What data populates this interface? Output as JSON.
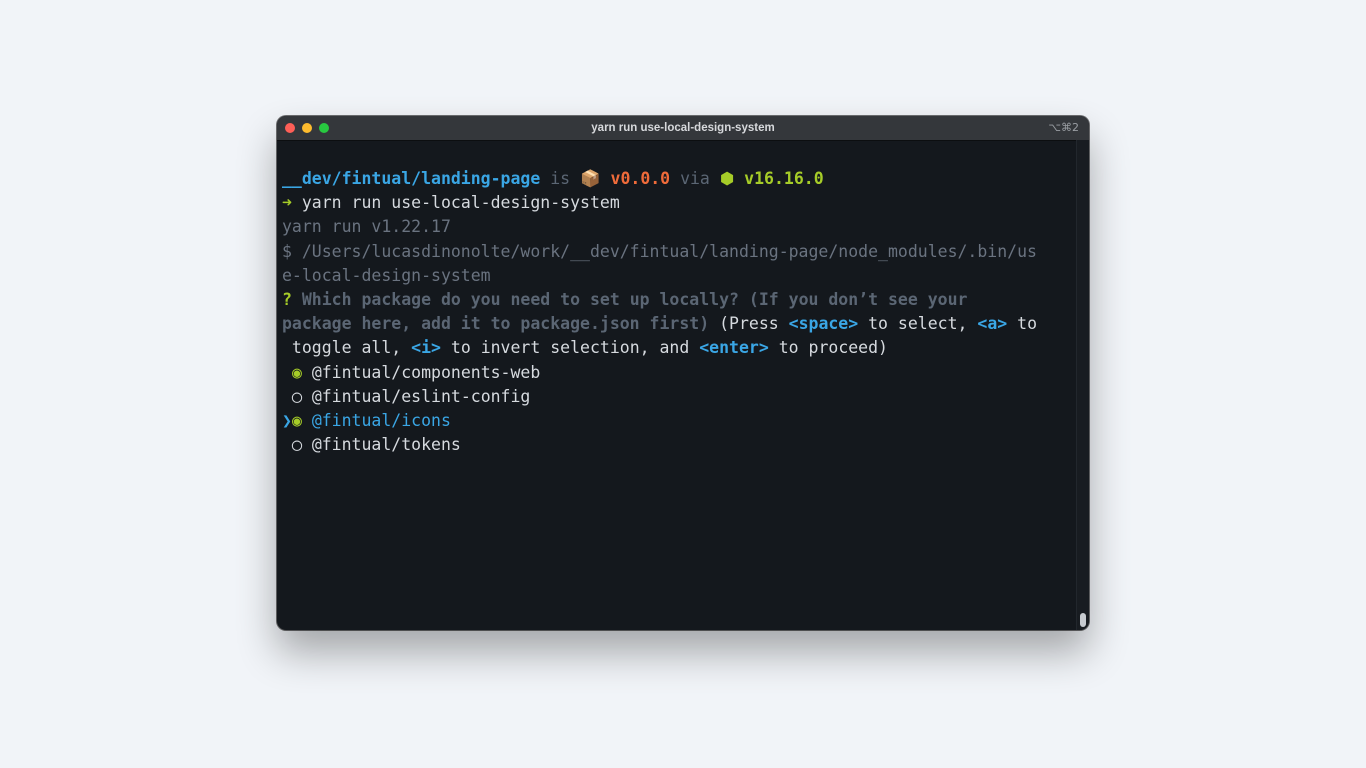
{
  "window": {
    "title": "yarn run use-local-design-system",
    "shortcut": "⌥⌘2"
  },
  "prompt": {
    "path": "__dev/fintual/landing-page",
    "is": "is",
    "package_icon": "📦",
    "version": "v0.0.0",
    "via": "via",
    "node_icon": "⬢",
    "node_version": "v16.16.0",
    "arrow": "➜",
    "command": "yarn run use-local-design-system"
  },
  "output": {
    "yarn_version": "yarn run v1.22.17",
    "exec_line_1": "$ /Users/lucasdinonolte/work/__dev/fintual/landing-page/node_modules/.bin/us",
    "exec_line_2": "e-local-design-system"
  },
  "question": {
    "mark": "?",
    "text_1": "Which package do you need to set up locally? (If you don’t see your",
    "text_2": "package here, add it to package.json first)",
    "press": "(Press ",
    "key_space": "<space>",
    "to_select": " to select, ",
    "key_a": "<a>",
    "to": " to",
    "toggle_all": " toggle all, ",
    "key_i": "<i>",
    "to_invert": " to invert selection, and ",
    "key_enter": "<enter>",
    "to_proceed": " to proceed)"
  },
  "choices": [
    {
      "label": "@fintual/components-web",
      "selected": true,
      "active": false,
      "marker": "◉",
      "pointer": " "
    },
    {
      "label": "@fintual/eslint-config",
      "selected": false,
      "active": false,
      "marker": "◯",
      "pointer": " "
    },
    {
      "label": "@fintual/icons",
      "selected": true,
      "active": true,
      "marker": "◉",
      "pointer": "❯"
    },
    {
      "label": "@fintual/tokens",
      "selected": false,
      "active": false,
      "marker": "◯",
      "pointer": " "
    }
  ],
  "colors": {
    "background": "#f1f4f8",
    "terminal": "#14181d",
    "blue": "#3aa6e5",
    "orange": "#ef6b3a",
    "lime": "#a6cc28",
    "muted": "#5b6674"
  }
}
